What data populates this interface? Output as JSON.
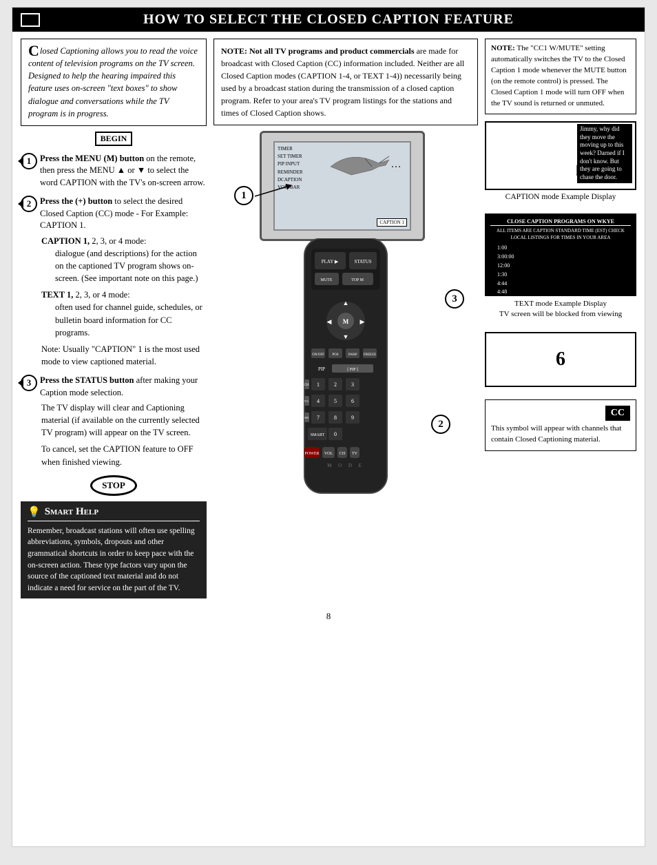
{
  "header": {
    "title": "How to Select the Closed Caption Feature"
  },
  "intro": {
    "text": "losed Captioning allows you to read the voice content of television programs on the TV screen. Designed to help the hearing impaired this feature uses on-screen \"text boxes\" to show dialogue and conversations while the TV program is in progress."
  },
  "begin_label": "BEGIN",
  "steps": [
    {
      "num": "1",
      "instruction": "Press the MENU (M) button on the remote, then press the MENU ▲ or ▼ to select the word CAPTION with the TV's on-screen arrow."
    },
    {
      "num": "2",
      "instruction": "Press the (+) button to select the desired Closed Caption (CC) mode - For Example: CAPTION 1."
    },
    {
      "num": "3",
      "instruction": "Press the STATUS button after making your Caption mode selection."
    }
  ],
  "caption_modes": {
    "caption_title": "CAPTION 1, 2, 3, or 4 mode:",
    "caption_desc": "dialogue (and descriptions) for the action on the captioned TV program shows on-screen. (See important note on this page.)",
    "text_title": "TEXT 1, 2, 3, or 4 mode:",
    "text_desc": "often used for channel guide, schedules, or bulletin board information for CC programs."
  },
  "note_usually": "Note: Usually \"CAPTION\" 1 is the most used mode to view captioned material.",
  "tv_display_paragraph": "The TV display will clear and Captioning material (if available on the currently selected TV program) will appear on the TV screen.",
  "cancel_text": "To cancel, set the CAPTION feature to OFF when finished viewing.",
  "stop_label": "STOP",
  "smart_help": {
    "title": "Smart Help",
    "body": "Remember, broadcast stations will often use spelling abbreviations, symbols, dropouts and other grammatical shortcuts in order to keep pace with the on-screen action. These type factors vary upon the source of the captioned text material and do not indicate a need for service on the part of the TV."
  },
  "note_top": {
    "text": "NOTE: Not all TV programs and product commercials are made for broadcast with Closed Caption (CC) information included. Neither are all Closed Caption modes (CAPTION 1-4, or TEXT 1-4)) necessarily being used by a broadcast station during the transmission of a closed caption program. Refer to your area's TV program listings for the stations and times of Closed Caption shows."
  },
  "right_note": {
    "text": "NOTE: The \"CC1 W/MUTE\" setting automatically switches the TV to the Closed Caption 1 mode whenever the MUTE button (on the remote control) is pressed. The Closed Caption 1 mode will turn OFF when the TV sound is returned or unmuted."
  },
  "caption_example_label": "CAPTION mode Example Display",
  "caption_screen_text": "Jimmy, why did they move the moving up to this week? Darned if I don't know. But they are going to chase the door.",
  "text_mode_label": "TEXT mode Example Display",
  "text_mode_note": "TV screen will be blocked from viewing",
  "text_mode_screen": {
    "title": "CLOSE CAPTION PROGRAMS ON WKYE",
    "subtitle": "ALL ITEMS ARE CAPTION STANDARD TIME (EST) CHECK LOCAL LISTINGS FOR TIMES IN YOUR AREA",
    "times": [
      "1:00",
      "3:00:00",
      "12:00",
      "1:30",
      "4:44",
      "4:48"
    ]
  },
  "box6_label": "6",
  "cc_badge": "CC",
  "cc_symbol_note": "This symbol will appear with channels that contain Closed Captioning material.",
  "tv_menu_items": [
    "TIMER",
    "SET TIMER",
    "PIP INPUT",
    "REMINDER",
    "DCAPTION",
    "VOL. BAR"
  ],
  "caption_box_label": "CAPTION 1",
  "circle_labels": [
    "1",
    "2",
    "3"
  ],
  "page_number": "8",
  "press_status_text": "Press STATUS button after",
  "press_button_text": "Press button"
}
